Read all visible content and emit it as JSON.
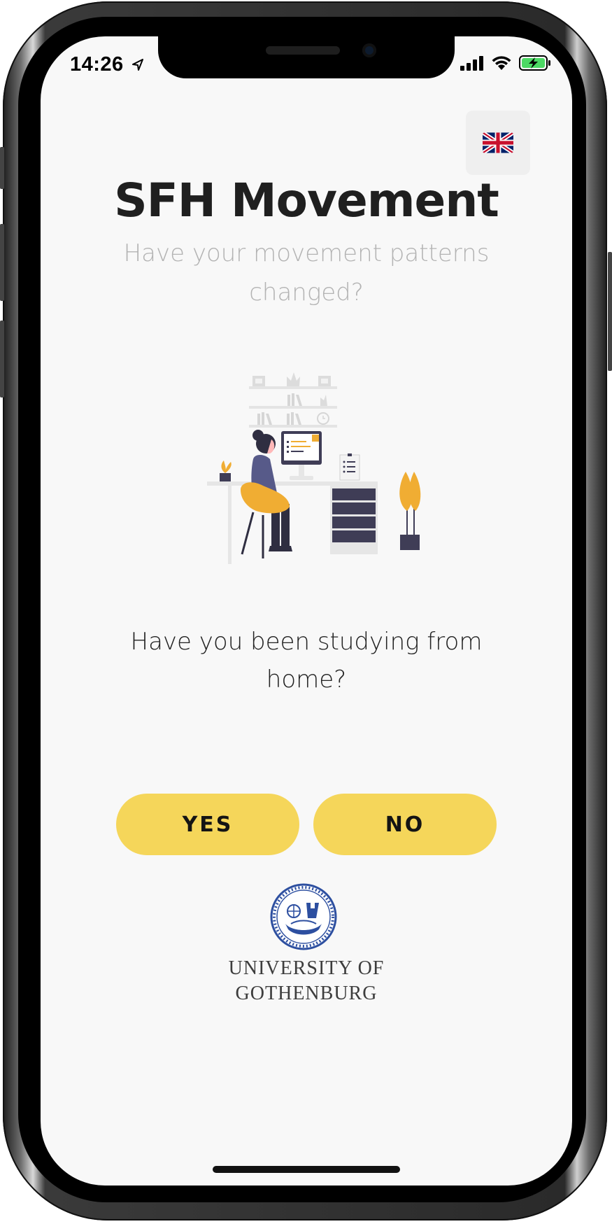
{
  "status_bar": {
    "time": "14:26",
    "icons": [
      "location-arrow-icon",
      "cellular-signal-icon",
      "wifi-icon",
      "battery-charging-icon"
    ]
  },
  "language": {
    "flag": "united-kingdom-flag-icon"
  },
  "header": {
    "title": "SFH Movement",
    "subtitle": "Have your movement patterns changed?"
  },
  "illustration": {
    "name": "person-studying-at-desk-illustration"
  },
  "question": {
    "text": "Have you been studying from home?"
  },
  "answers": {
    "yes_label": "YES",
    "no_label": "NO"
  },
  "footer": {
    "university_line1": "UNIVERSITY OF",
    "university_line2": "GOTHENBURG"
  },
  "colors": {
    "accent": "#f5d65a",
    "background": "#f8f8f8",
    "title": "#1f1f1f",
    "subtitle": "#b3b3b3",
    "logo_blue": "#2d4fa0"
  }
}
